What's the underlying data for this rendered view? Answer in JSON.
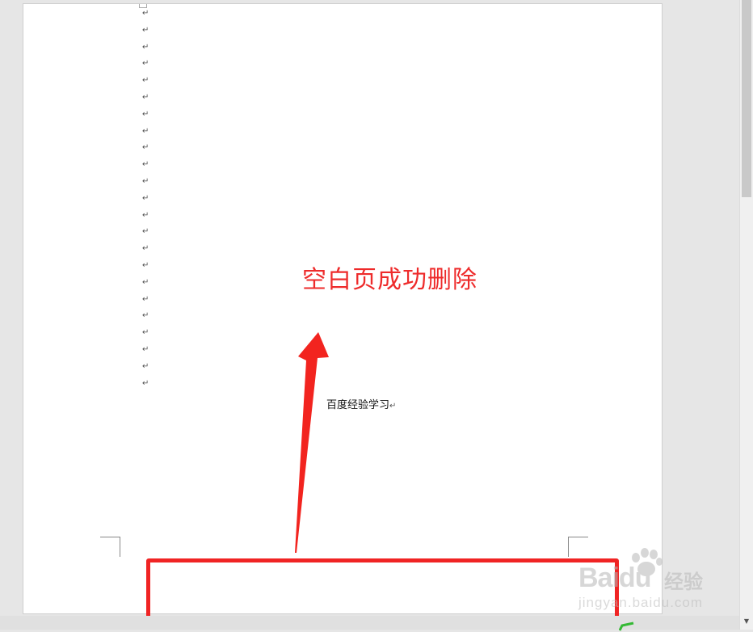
{
  "document": {
    "paragraph_mark": "↵",
    "body_text": "百度经验学习",
    "body_text_mark": "↵"
  },
  "annotation": {
    "text": "空白页成功删除",
    "color": "#ee2b2b"
  },
  "highlight": {
    "color": "#f02424"
  },
  "watermark": {
    "brand": "Bai",
    "brand_suffix": "du",
    "chinese": "经验",
    "url": "jingyan.baidu.com"
  },
  "scrollbar": {
    "down_arrow": "▼"
  }
}
